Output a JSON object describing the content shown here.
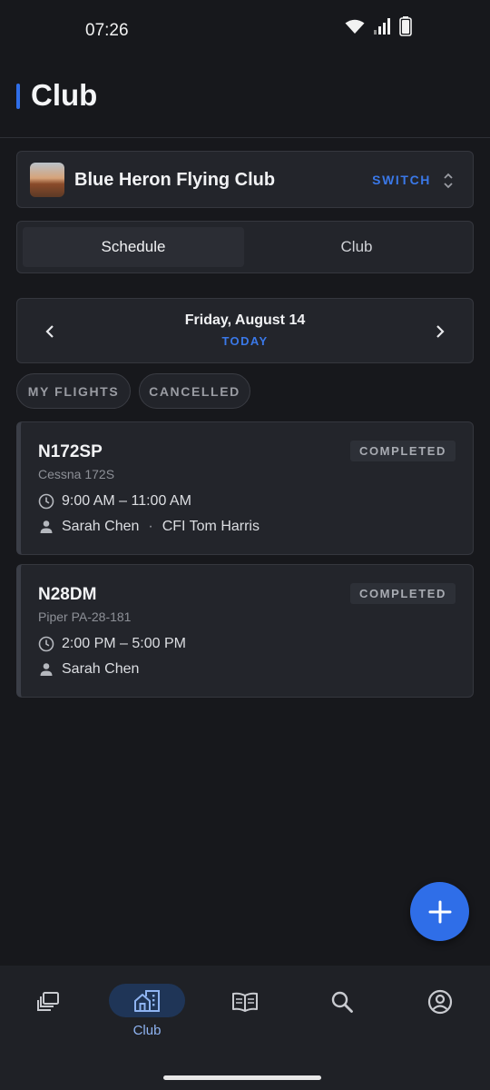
{
  "status_bar": {
    "time": "07:26"
  },
  "header": {
    "title": "Club"
  },
  "club": {
    "name": "Blue Heron Flying Club",
    "switch_label": "SWITCH"
  },
  "tabs": [
    {
      "label": "Schedule",
      "active": true
    },
    {
      "label": "Club",
      "active": false
    }
  ],
  "date_nav": {
    "date": "Friday, August 14",
    "today_label": "TODAY"
  },
  "filters": [
    {
      "label": "MY FLIGHTS"
    },
    {
      "label": "CANCELLED"
    }
  ],
  "flights": [
    {
      "tail": "N172SP",
      "model": "Cessna 172S",
      "status": "COMPLETED",
      "time": "9:00 AM – 11:00 AM",
      "pilot": "Sarah Chen",
      "instructor": "CFI Tom Harris"
    },
    {
      "tail": "N28DM",
      "model": "Piper PA-28-181",
      "status": "COMPLETED",
      "time": "2:00 PM – 5:00 PM",
      "pilot": "Sarah Chen"
    }
  ],
  "bottom_nav": [
    {
      "icon": "library-icon",
      "label": ""
    },
    {
      "icon": "club-icon",
      "label": "Club",
      "active": true
    },
    {
      "icon": "logbook-icon",
      "label": ""
    },
    {
      "icon": "search-icon",
      "label": ""
    },
    {
      "icon": "account-icon",
      "label": ""
    }
  ],
  "colors": {
    "accent": "#2f6ee8",
    "background": "#17181c",
    "card": "#23252b"
  }
}
